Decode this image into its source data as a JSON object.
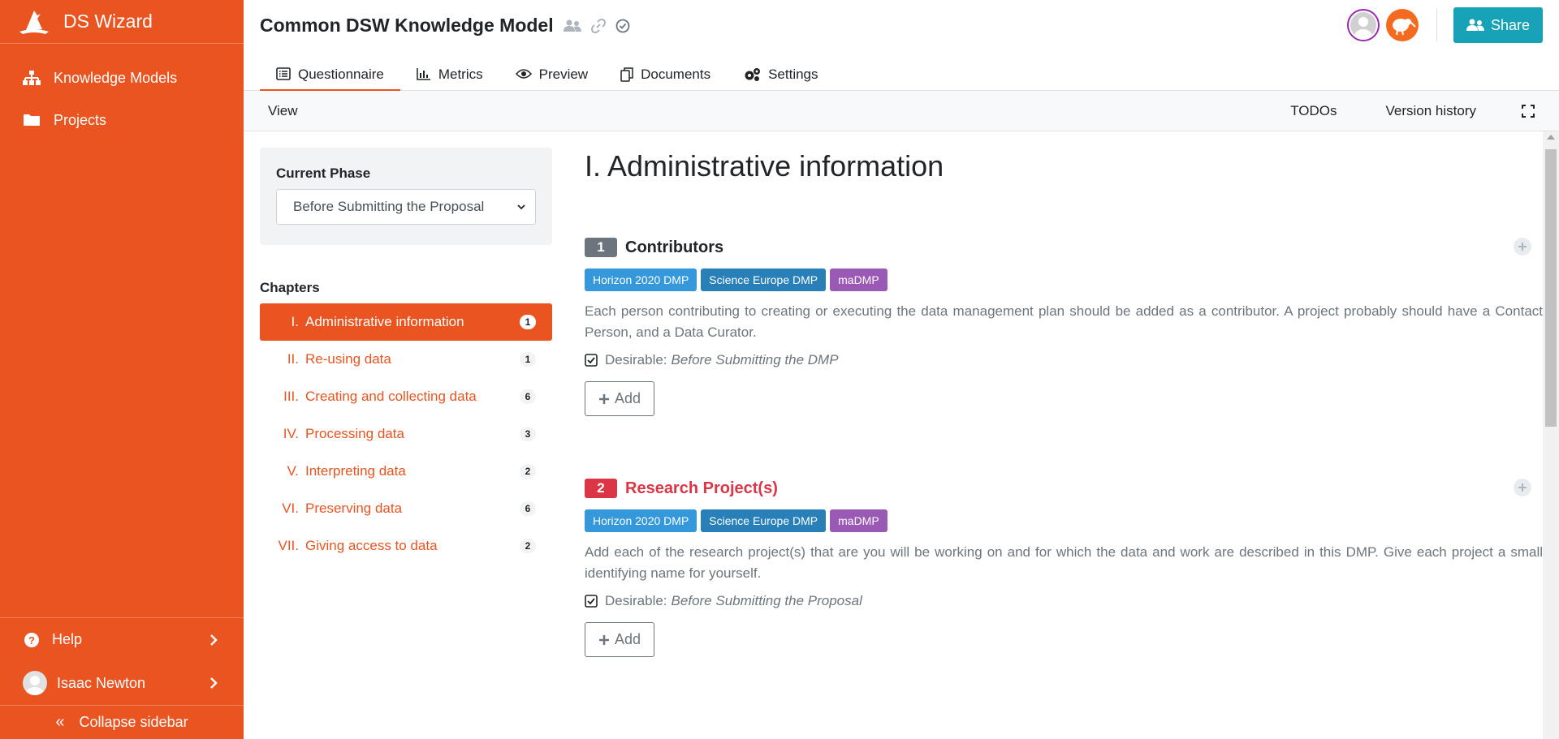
{
  "sidebar": {
    "brand": "DS Wizard",
    "items": [
      {
        "label": "Knowledge Models",
        "icon": "sitemap-icon"
      },
      {
        "label": "Projects",
        "icon": "folder-icon"
      }
    ],
    "help_label": "Help",
    "user_name": "Isaac Newton",
    "collapse_label": "Collapse sidebar"
  },
  "header": {
    "title": "Common DSW Knowledge Model",
    "tabs": [
      {
        "label": "Questionnaire",
        "icon": "list-icon",
        "active": true
      },
      {
        "label": "Metrics",
        "icon": "chart-icon"
      },
      {
        "label": "Preview",
        "icon": "eye-icon"
      },
      {
        "label": "Documents",
        "icon": "copy-icon"
      },
      {
        "label": "Settings",
        "icon": "gears-icon"
      }
    ],
    "share_label": "Share"
  },
  "toolbar": {
    "view_label": "View",
    "todos_label": "TODOs",
    "version_history_label": "Version history"
  },
  "left_panel": {
    "phase_label": "Current Phase",
    "phase_selected": "Before Submitting the Proposal",
    "chapters_label": "Chapters",
    "chapters": [
      {
        "num": "I.",
        "title": "Administrative information",
        "count": "1",
        "active": true
      },
      {
        "num": "II.",
        "title": "Re-using data",
        "count": "1"
      },
      {
        "num": "III.",
        "title": "Creating and collecting data",
        "count": "6"
      },
      {
        "num": "IV.",
        "title": "Processing data",
        "count": "3"
      },
      {
        "num": "V.",
        "title": "Interpreting data",
        "count": "2"
      },
      {
        "num": "VI.",
        "title": "Preserving data",
        "count": "6"
      },
      {
        "num": "VII.",
        "title": "Giving access to data",
        "count": "2"
      }
    ]
  },
  "main": {
    "chapter_title": "I. Administrative information",
    "questions": [
      {
        "number": "1",
        "title": "Contributors",
        "tags": [
          "Horizon 2020 DMP",
          "Science Europe DMP",
          "maDMP"
        ],
        "text": "Each person contributing to creating or executing the data management plan should be added as a contributor. A project probably should have a Contact Person, and a Data Curator.",
        "desirable_label": "Desirable:",
        "desirable_phase": "Before Submitting the DMP",
        "add_label": "Add"
      },
      {
        "number": "2",
        "title": "Research Project(s)",
        "tags": [
          "Horizon 2020 DMP",
          "Science Europe DMP",
          "maDMP"
        ],
        "text": "Add each of the research project(s) that are you will be working on and for which the data and work are described in this DMP. Give each project a small identifying name for yourself.",
        "desirable_label": "Desirable:",
        "desirable_phase": "Before Submitting the Proposal",
        "add_label": "Add"
      }
    ]
  },
  "colors": {
    "brand": "#e95420",
    "danger": "#dc3545",
    "share": "#17a2b8",
    "tag_horizon": "#3498db",
    "tag_science": "#2980b9",
    "tag_madmp": "#9b59b6"
  }
}
